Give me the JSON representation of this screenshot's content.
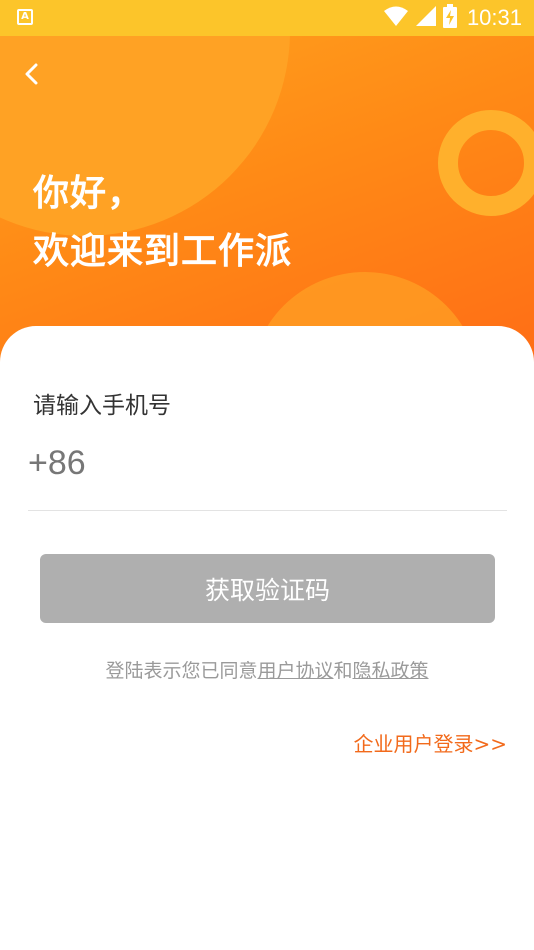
{
  "status_bar": {
    "left_icon": "A",
    "time": "10:31",
    "icons": [
      "wifi-icon",
      "signal-icon",
      "battery-charging-icon"
    ]
  },
  "header": {
    "back_icon": "chevron-left-icon",
    "greeting_line1": "你好，",
    "greeting_line2": "欢迎来到工作派",
    "colors": {
      "gradient_start": "#ffa21e",
      "gradient_end": "#ff6d16"
    }
  },
  "form": {
    "phone_label": "请输入手机号",
    "country_code": "+86",
    "phone_value": "",
    "get_code_label": "获取验证码"
  },
  "agreement": {
    "prefix": "登陆表示您已同意",
    "user_agreement": "用户协议",
    "conjunction": "和",
    "privacy_policy": "隐私政策"
  },
  "enterprise_login": "企业用户登录>>",
  "colors": {
    "accent": "#f26a1b",
    "button_disabled": "#afafaf"
  }
}
